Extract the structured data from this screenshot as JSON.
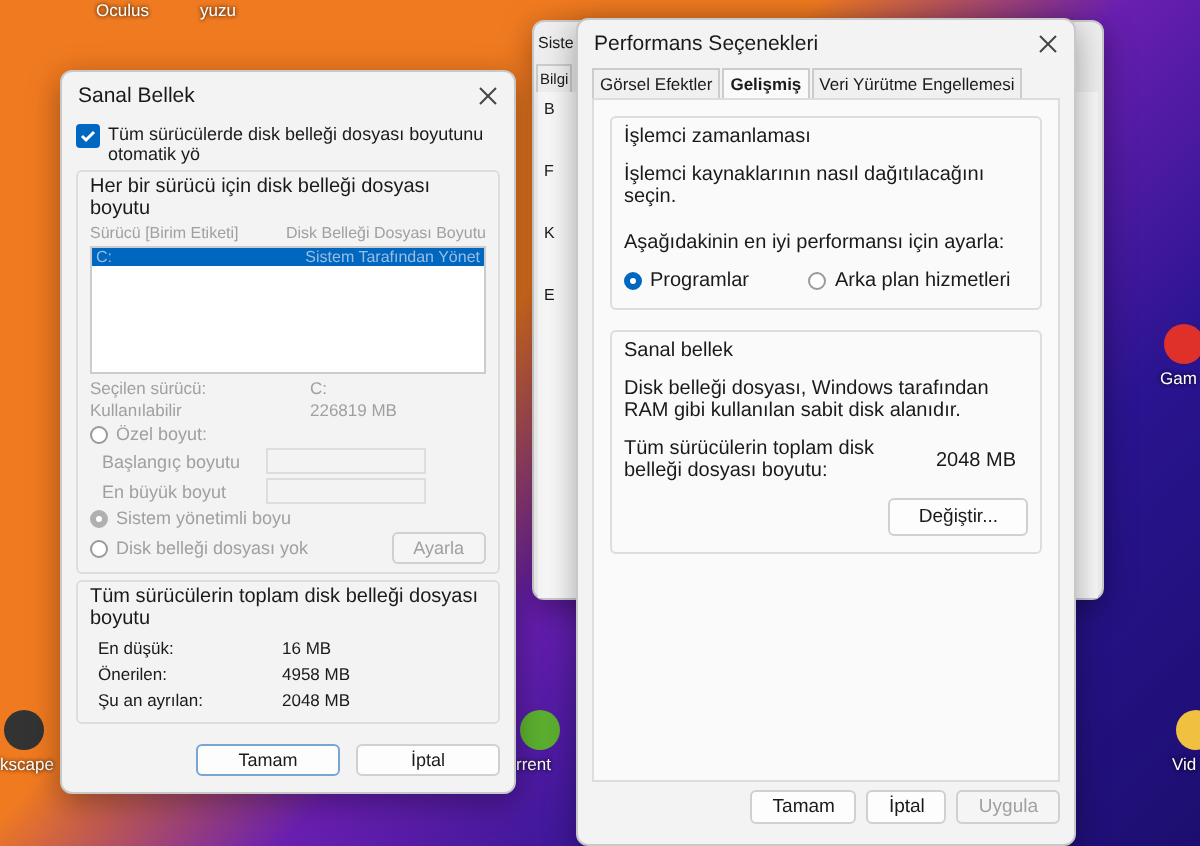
{
  "desktop_icons": [
    {
      "label": "Oculus"
    },
    {
      "label": "yuzu"
    },
    {
      "label": "Gam"
    },
    {
      "label": "kscape"
    },
    {
      "label": "rrent"
    },
    {
      "label": "Vid"
    }
  ],
  "back_window": {
    "title": "Siste",
    "tabs": [
      "Bilgi"
    ],
    "letters": [
      "B",
      "F",
      "K",
      "E"
    ]
  },
  "virtual_memory_dialog": {
    "title": "Sanal Bellek",
    "auto_checkbox": {
      "label": "Tüm sürücülerde disk belleği dosyası boyutunu otomatik yö",
      "checked": true
    },
    "per_drive": {
      "title": "Her bir sürücü için disk belleği dosyası boyutu",
      "disabled": true,
      "columns": [
        "Sürücü  [Birim Etiketi]",
        "Disk Belleği Dosyası Boyutu"
      ],
      "rows": [
        {
          "drive": "C:",
          "size": "Sistem Tarafından Yönet",
          "selected": true
        }
      ],
      "info": [
        {
          "label": "Seçilen sürücü:",
          "value": "C:"
        },
        {
          "label": "Kullanılabilir",
          "value": "226819 MB"
        }
      ],
      "custom_radio": {
        "label": "Özel boyut:",
        "selected": false
      },
      "fields": [
        {
          "label": "Başlangıç boyutu"
        },
        {
          "label": "En büyük boyut"
        }
      ],
      "other_radios": [
        {
          "label": "Sistem yönetimli boyu",
          "selected": true
        },
        {
          "label": "Disk belleği dosyası yok",
          "selected": false
        }
      ],
      "set_button": {
        "label": "Ayarla",
        "disabled": true
      }
    },
    "totals": {
      "title": "Tüm sürücülerin toplam disk belleği dosyası boyutu",
      "rows": [
        {
          "label": "En düşük:",
          "value": "16 MB"
        },
        {
          "label": "Önerilen:",
          "value": "4958 MB"
        },
        {
          "label": "Şu an ayrılan:",
          "value": "2048 MB"
        }
      ]
    },
    "buttons": [
      {
        "label": "Tamam",
        "default": true
      },
      {
        "label": "İptal",
        "default": false
      }
    ]
  },
  "performance_dialog": {
    "title": "Performans Seçenekleri",
    "tabs": [
      {
        "label": "Görsel Efektler",
        "selected": false
      },
      {
        "label": "Gelişmiş",
        "selected": true
      },
      {
        "label": "Veri Yürütme Engellemesi",
        "selected": false
      }
    ],
    "scheduling": {
      "title": "İşlemci zamanlaması",
      "description": "İşlemci kaynaklarının nasıl dağıtılacağını seçin.",
      "prompt": "Aşağıdakinin en iyi performansı için ayarla:",
      "options": [
        {
          "label": "Programlar",
          "selected": true
        },
        {
          "label": "Arka plan hizmetleri",
          "selected": false
        }
      ]
    },
    "virtual_memory": {
      "title": "Sanal bellek",
      "description": "Disk belleği dosyası, Windows tarafından RAM gibi kullanılan sabit disk alanıdır.",
      "total_label": "Tüm sürücülerin toplam disk belleği dosyası boyutu:",
      "total_value": "2048 MB",
      "change_button": "Değiştir..."
    },
    "buttons": [
      {
        "label": "Tamam",
        "disabled": false
      },
      {
        "label": "İptal",
        "disabled": false
      },
      {
        "label": "Uygula",
        "disabled": true
      }
    ]
  }
}
